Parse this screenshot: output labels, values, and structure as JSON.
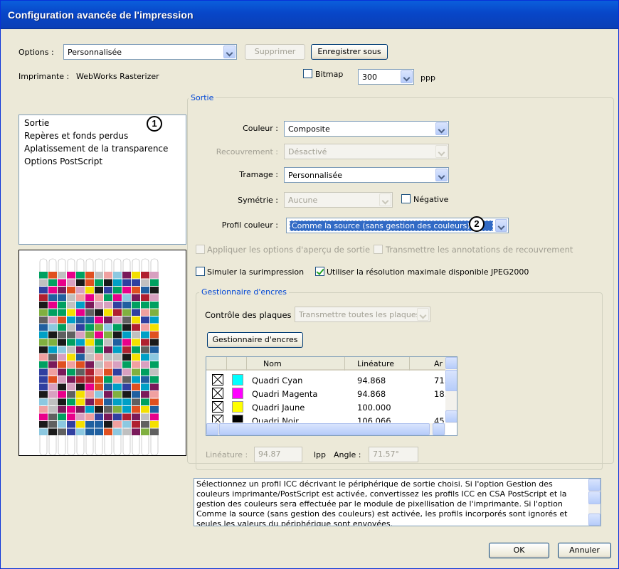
{
  "window": {
    "title": "Configuration avancée de l'impression"
  },
  "options": {
    "label": "Options :",
    "value": "Personnalisée",
    "delete_label": "Supprimer",
    "save_as_label": "Enregistrer sous"
  },
  "printer": {
    "label": "Imprimante :",
    "name": "WebWorks Rasterizer"
  },
  "bitmap": {
    "label": "Bitmap",
    "resolution": "300",
    "unit": "ppp"
  },
  "sidebar": {
    "items": [
      {
        "label": "Sortie"
      },
      {
        "label": "Repères et fonds perdus"
      },
      {
        "label": "Aplatissement de la transparence"
      },
      {
        "label": "Options PostScript"
      }
    ]
  },
  "callouts": {
    "c1": "1",
    "c2": "2"
  },
  "output": {
    "group_label": "Sortie",
    "color": {
      "label": "Couleur :",
      "value": "Composite"
    },
    "trapping": {
      "label": "Recouvrement :",
      "value": "Désactivé"
    },
    "screening": {
      "label": "Tramage :",
      "value": "Personnalisée"
    },
    "mirror": {
      "label": "Symétrie :",
      "value": "Aucune"
    },
    "negative_label": "Négative",
    "color_profile": {
      "label": "Profil couleur :",
      "value": "Comme la source (sans gestion des couleurs)"
    },
    "apply_preview_label": "Appliquer les options d'aperçu de sortie",
    "transmit_trap_label": "Transmettre les annotations de recouvrement",
    "simulate_overprint_label": "Simuler la surimpression",
    "use_max_res_label": "Utiliser la résolution maximale disponible JPEG2000"
  },
  "ink_manager": {
    "group_label": "Gestionnaire d'encres",
    "plate_control": {
      "label": "Contrôle des plaques",
      "value": "Transmettre toutes les plaques"
    },
    "button_label": "Gestionnaire d'encres",
    "columns": [
      "Nom",
      "Linéature",
      "Ar"
    ],
    "rows": [
      {
        "name": "Quadri Cyan",
        "freq": "94.868",
        "angle": "71.",
        "color": "#00ffff"
      },
      {
        "name": "Quadri Magenta",
        "freq": "94.868",
        "angle": "18.",
        "color": "#ff00ff"
      },
      {
        "name": "Quadri Jaune",
        "freq": "100.000",
        "angle": "",
        "color": "#ffff00"
      },
      {
        "name": "Quadri Noir",
        "freq": "106.066",
        "angle": "45.",
        "color": "#000000"
      }
    ],
    "freq_label": "Linéature :",
    "freq_value": "94.87",
    "freq_unit": "lpp",
    "angle_label": "Angle :",
    "angle_value": "71.57°"
  },
  "description": "Sélectionnez un profil ICC décrivant le périphérique de sortie choisi. Si l'option Gestion des couleurs imprimante/PostScript est activée, convertissez les profils ICC en CSA PostScript et la gestion des couleurs sera effectuée par le module de pixellisation de l'imprimante. Si l'option Comme la source (sans gestion des couleurs) est activée, les profils incorporés sont ignorés et seules les valeurs du périphérique sont envoyées.",
  "footer": {
    "ok_label": "OK",
    "cancel_label": "Annuler"
  }
}
